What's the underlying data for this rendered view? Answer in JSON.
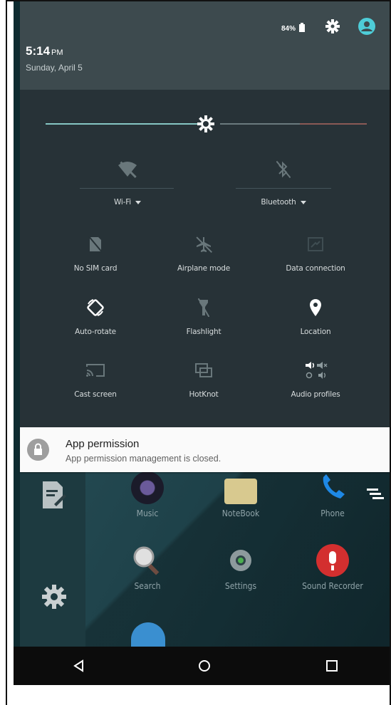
{
  "status": {
    "time": "5:14",
    "ampm": "PM",
    "date": "Sunday, April 5",
    "battery": "84%"
  },
  "brightness": {
    "level": 0.53
  },
  "quick_settings": {
    "wifi": {
      "label": "Wi-Fi",
      "icon": "wifi-off-icon"
    },
    "bluetooth": {
      "label": "Bluetooth",
      "icon": "bluetooth-off-icon"
    },
    "tiles": [
      {
        "label": "No SIM card",
        "icon": "no-sim-icon"
      },
      {
        "label": "Airplane mode",
        "icon": "airplane-icon"
      },
      {
        "label": "Data connection",
        "icon": "data-connection-icon"
      },
      {
        "label": "Auto-rotate",
        "icon": "auto-rotate-icon"
      },
      {
        "label": "Flashlight",
        "icon": "flashlight-icon"
      },
      {
        "label": "Location",
        "icon": "location-icon"
      },
      {
        "label": "Cast screen",
        "icon": "cast-icon"
      },
      {
        "label": "HotKnot",
        "icon": "hotknot-icon"
      },
      {
        "label": "Audio profiles",
        "icon": "audio-profiles-icon"
      }
    ]
  },
  "notification": {
    "title": "App permission",
    "text": "App permission management is closed."
  },
  "home": {
    "apps": [
      {
        "label": "Music"
      },
      {
        "label": "NoteBook"
      },
      {
        "label": "Phone"
      },
      {
        "label": "Search"
      },
      {
        "label": "Settings"
      },
      {
        "label": "Sound Recorder"
      }
    ]
  },
  "colors": {
    "accent": "#4ecdd8",
    "shade_header": "#3d4a4e",
    "shade_body": "#273237",
    "notification_bg": "#fafafa"
  }
}
